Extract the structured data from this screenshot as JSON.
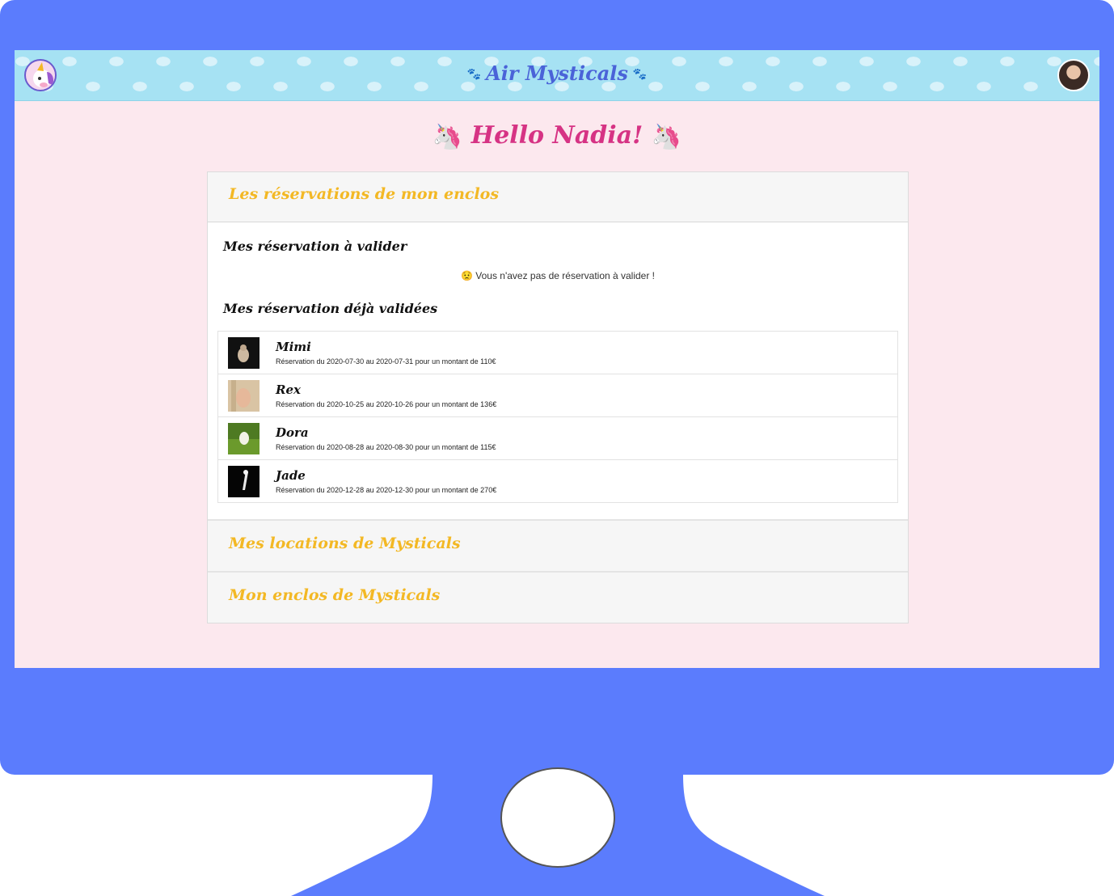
{
  "header": {
    "brand": "Air Mysticals",
    "paw_icon": "paw-icon"
  },
  "greeting": {
    "text": "Hello Nadia!",
    "unicorn": "🦄"
  },
  "accordion": {
    "sections": [
      {
        "title": "Les réservations de mon enclos",
        "expanded": true
      },
      {
        "title": "Mes locations de Mysticals",
        "expanded": false
      },
      {
        "title": "Mon enclos de Mysticals",
        "expanded": false
      }
    ],
    "pending_title": "Mes réservation à valider",
    "pending_empty": "Vous n'avez pas de réservation à valider !",
    "pending_empty_emoji": "😟",
    "validated_title": "Mes réservation déjà validées",
    "validated": [
      {
        "name": "Mimi",
        "desc": "Réservation du 2020-07-30 au 2020-07-31 pour un montant de 110€"
      },
      {
        "name": "Rex",
        "desc": "Réservation du 2020-10-25 au 2020-10-26 pour un montant de 136€"
      },
      {
        "name": "Dora",
        "desc": "Réservation du 2020-08-28 au 2020-08-30 pour un montant de 115€"
      },
      {
        "name": "Jade",
        "desc": "Réservation du 2020-12-28 au 2020-12-30 pour un montant de 270€"
      }
    ]
  },
  "colors": {
    "frame": "#5b7cfd",
    "screen_bg": "#fce8ee",
    "header_bg": "#a6e2f3",
    "brand": "#4a63d8",
    "greeting": "#d63384",
    "section_title": "#f3b824"
  }
}
